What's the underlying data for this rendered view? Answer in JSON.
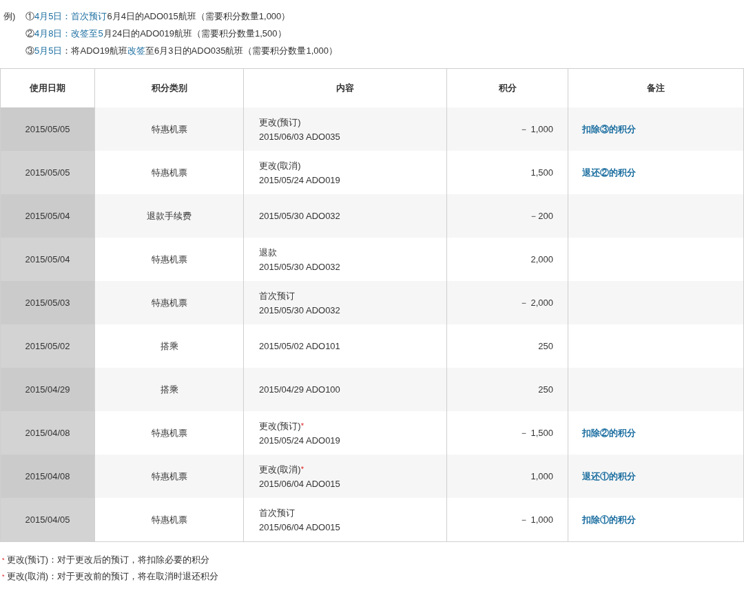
{
  "example": {
    "label": "例)",
    "lines": [
      [
        {
          "text": "①",
          "highlight": false
        },
        {
          "text": "4月5日：首次预订",
          "highlight": true
        },
        {
          "text": "6月4日的ADO015航班（需要积分数量1,000）",
          "highlight": false
        }
      ],
      [
        {
          "text": "②",
          "highlight": false
        },
        {
          "text": "4月8日：改签至5",
          "highlight": true
        },
        {
          "text": "月24日的ADO019航班（需要积分数量1,500）",
          "highlight": false
        }
      ],
      [
        {
          "text": "③",
          "highlight": false
        },
        {
          "text": "5月5日",
          "highlight": true
        },
        {
          "text": "：将ADO19航班",
          "highlight": false
        },
        {
          "text": "改签",
          "highlight": true
        },
        {
          "text": "至6月3日的ADO035航班（需要积分数量1,000）",
          "highlight": false
        }
      ]
    ]
  },
  "table": {
    "columns": [
      "使用日期",
      "积分类别",
      "内容",
      "积分",
      "备注"
    ],
    "rows": [
      {
        "date": "2015/05/05",
        "category": "特惠机票",
        "content": [
          "更改(预订)",
          "2015/06/03 ADO035"
        ],
        "mark": "",
        "points": "－ 1,000",
        "remark": "扣除③的积分"
      },
      {
        "date": "2015/05/05",
        "category": "特惠机票",
        "content": [
          "更改(取消)",
          "2015/05/24 ADO019"
        ],
        "mark": "",
        "points": "1,500",
        "remark": "退还②的积分"
      },
      {
        "date": "2015/05/04",
        "category": "退款手续费",
        "content": [
          "2015/05/30 ADO032"
        ],
        "mark": "",
        "points": "－200",
        "remark": ""
      },
      {
        "date": "2015/05/04",
        "category": "特惠机票",
        "content": [
          "退款",
          "2015/05/30 ADO032"
        ],
        "mark": "",
        "points": "2,000",
        "remark": ""
      },
      {
        "date": "2015/05/03",
        "category": "特惠机票",
        "content": [
          "首次预订",
          "2015/05/30 ADO032"
        ],
        "mark": "",
        "points": "－ 2,000",
        "remark": ""
      },
      {
        "date": "2015/05/02",
        "category": "搭乘",
        "content": [
          "2015/05/02 ADO101"
        ],
        "mark": "",
        "points": "250",
        "remark": ""
      },
      {
        "date": "2015/04/29",
        "category": "搭乘",
        "content": [
          "2015/04/29 ADO100"
        ],
        "mark": "",
        "points": "250",
        "remark": ""
      },
      {
        "date": "2015/04/08",
        "category": "特惠机票",
        "content": [
          "更改(预订)",
          "2015/05/24 ADO019"
        ],
        "mark": "*",
        "points": "－ 1,500",
        "remark": "扣除②的积分"
      },
      {
        "date": "2015/04/08",
        "category": "特惠机票",
        "content": [
          "更改(取消)",
          "2015/06/04 ADO015"
        ],
        "mark": "*",
        "points": "1,000",
        "remark": "退还①的积分"
      },
      {
        "date": "2015/04/05",
        "category": "特惠机票",
        "content": [
          "首次预订",
          "2015/06/04 ADO015"
        ],
        "mark": "",
        "points": "－ 1,000",
        "remark": "扣除①的积分"
      }
    ]
  },
  "notes": [
    {
      "marker": "*",
      "text": "更改(预订)：对于更改后的预订，将扣除必要的积分"
    },
    {
      "marker": "*",
      "text": "更改(取消)：对于更改前的预订，将在取消时退还积分"
    }
  ]
}
